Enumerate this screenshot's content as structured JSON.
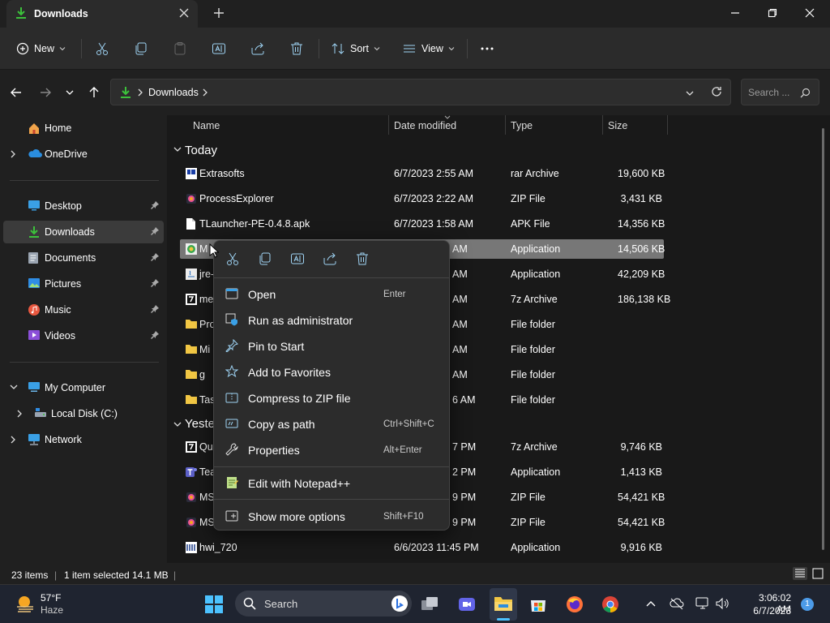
{
  "window": {
    "tab_title": "Downloads",
    "colors": {
      "accent": "#4cc2ff",
      "selection": "#777777",
      "background": "#191919",
      "folder": "#f2c744",
      "green": "#3cc13b"
    }
  },
  "toolbar": {
    "new_label": "New",
    "sort_label": "Sort",
    "view_label": "View",
    "icons": [
      "cut-icon",
      "copy-icon",
      "paste-icon",
      "rename-icon",
      "share-icon",
      "delete-icon"
    ]
  },
  "address": {
    "path": "Downloads",
    "search_placeholder": "Search ..."
  },
  "sidebar": {
    "items": [
      {
        "label": "Home",
        "icon": "home-icon"
      },
      {
        "label": "OneDrive",
        "icon": "onedrive-icon"
      },
      {
        "label": "Desktop",
        "icon": "desktop-icon"
      },
      {
        "label": "Downloads",
        "icon": "downloads-icon"
      },
      {
        "label": "Documents",
        "icon": "documents-icon"
      },
      {
        "label": "Pictures",
        "icon": "pictures-icon"
      },
      {
        "label": "Music",
        "icon": "music-icon"
      },
      {
        "label": "Videos",
        "icon": "videos-icon"
      },
      {
        "label": "My Computer",
        "icon": "computer-icon"
      },
      {
        "label": "Local Disk (C:)",
        "icon": "disk-icon"
      },
      {
        "label": "Network",
        "icon": "network-icon"
      }
    ]
  },
  "columns": {
    "name": "Name",
    "date": "Date modified",
    "type": "Type",
    "size": "Size"
  },
  "groups": {
    "today": "Today",
    "yesterday": "Yeste"
  },
  "files": [
    {
      "name": "Extrasofts",
      "date": "6/7/2023 2:55 AM",
      "type": "rar Archive",
      "size": "19,600 KB"
    },
    {
      "name": "ProcessExplorer",
      "date": "6/7/2023 2:22 AM",
      "type": "ZIP File",
      "size": "3,431 KB"
    },
    {
      "name": "TLauncher-PE-0.4.8.apk",
      "date": "6/7/2023 1:58 AM",
      "type": "APK File",
      "size": "14,356 KB"
    },
    {
      "name": "M",
      "date": "AM",
      "type": "Application",
      "size": "14,506 KB"
    },
    {
      "name": "jre-",
      "date": "AM",
      "type": "Application",
      "size": "42,209 KB"
    },
    {
      "name": "me",
      "date": "AM",
      "type": "7z Archive",
      "size": "186,138 KB"
    },
    {
      "name": "Pro",
      "date": "AM",
      "type": "File folder",
      "size": ""
    },
    {
      "name": "Mi",
      "date": "AM",
      "type": "File folder",
      "size": ""
    },
    {
      "name": "g",
      "date": "AM",
      "type": "File folder",
      "size": ""
    },
    {
      "name": "Tas",
      "date": "6 AM",
      "type": "File folder",
      "size": ""
    },
    {
      "name": "Qu",
      "date": "7 PM",
      "type": "7z Archive",
      "size": "9,746 KB"
    },
    {
      "name": "Tea",
      "date": "2 PM",
      "type": "Application",
      "size": "1,413 KB"
    },
    {
      "name": "MS",
      "date": "9 PM",
      "type": "ZIP File",
      "size": "54,421 KB"
    },
    {
      "name": "MS",
      "date": "9 PM",
      "type": "ZIP File",
      "size": "54,421 KB"
    },
    {
      "name": "hwi_720",
      "date": "6/6/2023 11:45 PM",
      "type": "Application",
      "size": "9,916 KB"
    }
  ],
  "context_menu": {
    "items": [
      {
        "label": "Open",
        "shortcut": "Enter",
        "icon": "open-icon"
      },
      {
        "label": "Run as administrator",
        "shortcut": "",
        "icon": "shield-icon"
      },
      {
        "label": "Pin to Start",
        "shortcut": "",
        "icon": "pin-icon"
      },
      {
        "label": "Add to Favorites",
        "shortcut": "",
        "icon": "star-icon"
      },
      {
        "label": "Compress to ZIP file",
        "shortcut": "",
        "icon": "zip-icon"
      },
      {
        "label": "Copy as path",
        "shortcut": "Ctrl+Shift+C",
        "icon": "path-icon"
      },
      {
        "label": "Properties",
        "shortcut": "Alt+Enter",
        "icon": "wrench-icon"
      },
      {
        "label": "Edit with Notepad++",
        "shortcut": "",
        "icon": "notepad-icon"
      },
      {
        "label": "Show more options",
        "shortcut": "Shift+F10",
        "icon": "more-options-icon"
      }
    ]
  },
  "status": {
    "count": "23 items",
    "selected": "1 item selected",
    "size": "14.1 MB"
  },
  "taskbar": {
    "weather_temp": "57°F",
    "weather_desc": "Haze",
    "search_label": "Search",
    "time": "3:06:02 AM",
    "date": "6/7/2023",
    "notifications": "1"
  }
}
